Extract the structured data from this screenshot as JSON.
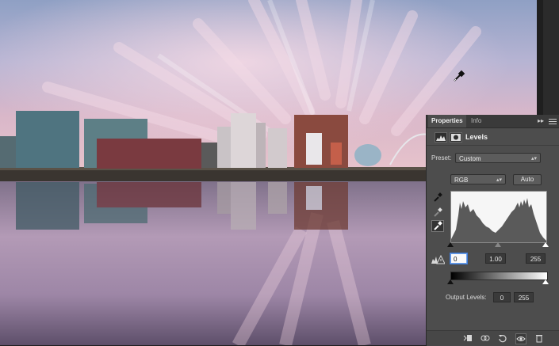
{
  "panel": {
    "tabs": [
      "Properties",
      "Info"
    ],
    "collapse_glyph": "▸▸",
    "adjustment_title": "Levels",
    "preset_label": "Preset:",
    "preset_value": "Custom",
    "channel_value": "RGB",
    "auto_label": "Auto",
    "input_levels": {
      "black": "0",
      "gamma": "1.00",
      "white": "255"
    },
    "output_levels_label": "Output Levels:",
    "output_levels": {
      "black": "0",
      "white": "255"
    }
  },
  "icons": {
    "header": [
      "levels-adjustment-icon",
      "layer-mask-icon"
    ],
    "tools": [
      "black-point-eyedropper-icon",
      "gray-point-eyedropper-icon",
      "white-point-eyedropper-icon"
    ],
    "clipping_warning": "clipping-warning-icon",
    "footer": [
      "clip-to-layer-icon",
      "view-previous-state-icon",
      "reset-icon",
      "visibility-eye-icon",
      "trash-icon"
    ]
  },
  "colors": {
    "panel_bg": "#4d4d4d",
    "tab_bar": "#3a3a3a",
    "focus_ring": "#3d7ad6"
  }
}
